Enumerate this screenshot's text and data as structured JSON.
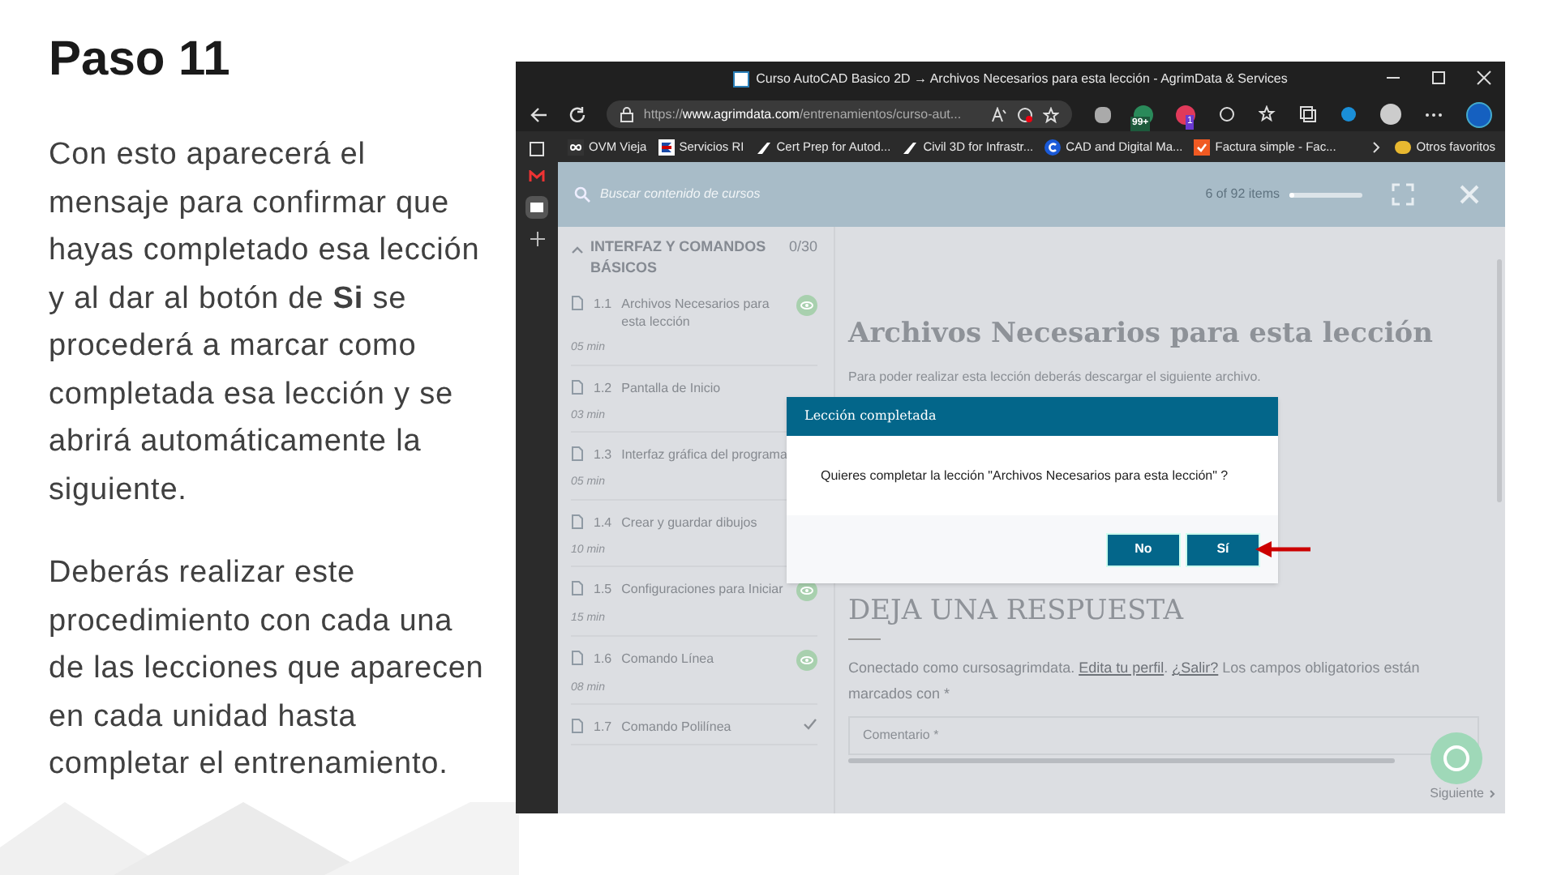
{
  "slide": {
    "title": "Paso 11",
    "paragraphs": [
      "Con esto aparecerá el mensaje para confirmar que hayas completado esa lección y al dar al botón de **Si** se procederá a marcar como completada esa lección y se abrirá automáticamente  la siguiente.",
      "Deberás realizar este procedimiento con cada una de las lecciones que aparecen en cada unidad hasta completar el entrenamiento."
    ]
  },
  "browser": {
    "title": "Curso AutoCAD Basico 2D → Archivos Necesarios para esta lección - AgrimData & Services",
    "url_prefix": "https://",
    "url_domain": "www.agrimdata.com",
    "url_rest": "/entrenamientos/curso-aut...",
    "badges": [
      "99+",
      "1"
    ],
    "bookmarks": [
      {
        "label": "OVM Vieja",
        "kind": "infinity"
      },
      {
        "label": "Servicios RI",
        "kind": "flag"
      },
      {
        "label": "Cert Prep for Autod...",
        "kind": "autodesk"
      },
      {
        "label": "Civil 3D for Infrastr...",
        "kind": "autodesk"
      },
      {
        "label": "CAD and Digital Ma...",
        "kind": "c"
      },
      {
        "label": "Factura simple - Fac...",
        "kind": "check"
      }
    ],
    "other_favorites": "Otros favoritos"
  },
  "course": {
    "search_placeholder": "Buscar contenido de cursos",
    "progress_text": "6 of 92 items",
    "progress": {
      "level": 0.07
    },
    "section": {
      "title": "INTERFAZ Y COMANDOS BÁSICOS",
      "count": "0/30",
      "expanded": true
    },
    "lessons": [
      {
        "number": "1.1",
        "title": "Archivos Necesarios para esta lección",
        "duration": "05 min",
        "viewed": true,
        "completed": false
      },
      {
        "number": "1.2",
        "title": "Pantalla de Inicio",
        "duration": "03 min",
        "viewed": false,
        "completed": false
      },
      {
        "number": "1.3",
        "title": "Interfaz gráfica del programa",
        "duration": "05 min",
        "viewed": false,
        "completed": false
      },
      {
        "number": "1.4",
        "title": "Crear y guardar dibujos",
        "duration": "10 min",
        "viewed": false,
        "completed": false
      },
      {
        "number": "1.5",
        "title": "Configuraciones para Iniciar",
        "duration": "15 min",
        "viewed": true,
        "completed": false
      },
      {
        "number": "1.6",
        "title": "Comando Línea",
        "duration": "08 min",
        "viewed": true,
        "completed": false
      },
      {
        "number": "1.7",
        "title": "Comando Polilínea",
        "viewed": false,
        "completed": true
      }
    ],
    "lesson_title": "Archivos Necesarios para esta lección",
    "lesson_text": "Para poder realizar esta lección deberás descargar el siguiente archivo.",
    "reply_heading": "DEJA UNA RESPUESTA",
    "logged_in_text": "Conectado como cursosagrimdata.",
    "edit_profile": "Edita tu perfil",
    "separator": ".",
    "logout": "¿Salir?",
    "required_text": "Los campos obligatorios están marcados con *",
    "comment_placeholder": "Comentario *",
    "next": "Siguiente"
  },
  "dialog": {
    "title": "Lección completada",
    "message": "Quieres completar la lección \"Archivos Necesarios para esta lección\" ?",
    "buttons": [
      "No",
      "Sí"
    ]
  }
}
